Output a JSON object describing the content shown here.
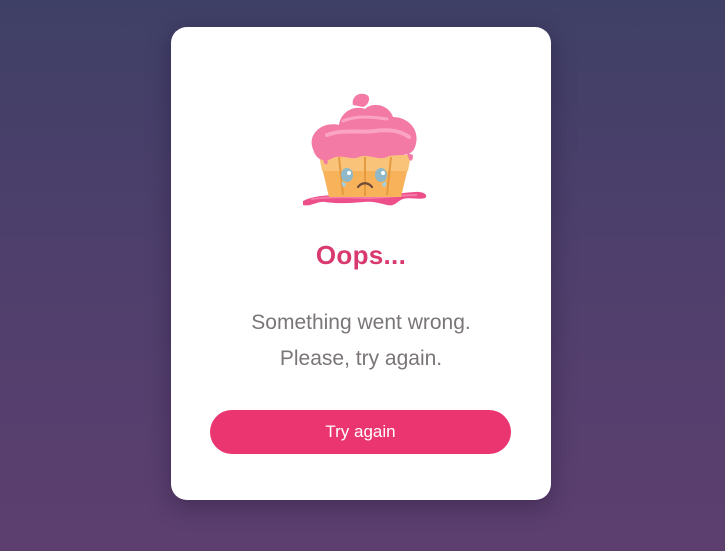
{
  "dialog": {
    "title": "Oops...",
    "message_line1": "Something went wrong.",
    "message_line2": "Please, try again.",
    "retry_label": "Try again"
  },
  "icons": {
    "illustration": "crying-cupcake-icon"
  },
  "colors": {
    "background_top": "#3f4066",
    "background_bottom": "#5d3f6f",
    "title": "#d93a6e",
    "button": "#ea3570",
    "text": "#7a7578"
  }
}
